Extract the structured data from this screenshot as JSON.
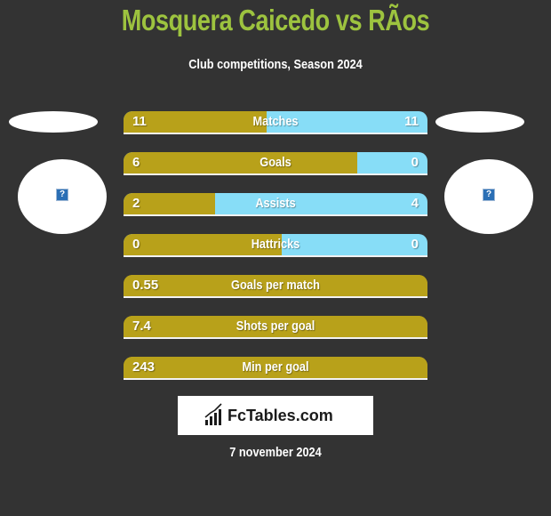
{
  "header": {
    "title": "Mosquera Caicedo vs RÃos",
    "subtitle": "Club competitions, Season 2024"
  },
  "players": {
    "left": {
      "avatar_icon": "unknown-image-icon",
      "avatar_glyph": "?"
    },
    "right": {
      "avatar_icon": "unknown-image-icon",
      "avatar_glyph": "?"
    }
  },
  "colors": {
    "background": "#333333",
    "title": "#9dc33f",
    "left_bar": "#b8a11a",
    "right_bar": "#87ddf7"
  },
  "stats": [
    {
      "label": "Matches",
      "left": "11",
      "right": "11",
      "left_fraction": 0.47
    },
    {
      "label": "Goals",
      "left": "6",
      "right": "0",
      "left_fraction": 0.77
    },
    {
      "label": "Assists",
      "left": "2",
      "right": "4",
      "left_fraction": 0.3
    },
    {
      "label": "Hattricks",
      "left": "0",
      "right": "0",
      "left_fraction": 0.52
    },
    {
      "label": "Goals per match",
      "left": "0.55",
      "right": "",
      "left_fraction": 1.0
    },
    {
      "label": "Shots per goal",
      "left": "7.4",
      "right": "",
      "left_fraction": 1.0
    },
    {
      "label": "Min per goal",
      "left": "243",
      "right": "",
      "left_fraction": 1.0
    }
  ],
  "footer": {
    "logo_text": "FcTables.com",
    "date": "7 november 2024"
  }
}
